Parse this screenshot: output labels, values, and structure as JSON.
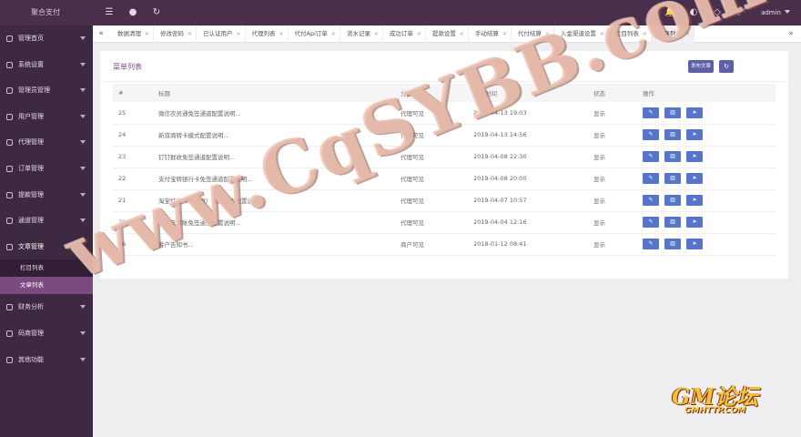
{
  "topbar": {
    "brand": "聚合支付",
    "admin": "admin"
  },
  "sidebar": {
    "items": [
      {
        "label": "管理首页"
      },
      {
        "label": "系统设置"
      },
      {
        "label": "管理员管理"
      },
      {
        "label": "用户管理"
      },
      {
        "label": "代理管理"
      },
      {
        "label": "订单管理"
      },
      {
        "label": "提款管理"
      },
      {
        "label": "通道管理"
      },
      {
        "label": "文章管理"
      }
    ],
    "sub_items": [
      {
        "label": "栏目列表"
      },
      {
        "label": "文章列表"
      }
    ],
    "items_after": [
      {
        "label": "财务分析"
      },
      {
        "label": "码商管理"
      },
      {
        "label": "其他功能"
      }
    ]
  },
  "tabs": [
    {
      "label": "数据清理"
    },
    {
      "label": "修改密码"
    },
    {
      "label": "已认证用户"
    },
    {
      "label": "代理列表"
    },
    {
      "label": "代付Api订单"
    },
    {
      "label": "流水记录"
    },
    {
      "label": "成功订单"
    },
    {
      "label": "提款设置"
    },
    {
      "label": "手动结算"
    },
    {
      "label": "代付结算"
    },
    {
      "label": "入金渠道设置"
    },
    {
      "label": "栏目列表"
    },
    {
      "label": "文章列表"
    }
  ],
  "card": {
    "title": "菜单列表",
    "add_label": "发布文章",
    "columns": {
      "id": "#",
      "title": "标题",
      "group": "分组",
      "time": "发表时间",
      "status": "状态",
      "ops": "操作"
    },
    "rows": [
      {
        "id": "25",
        "title": "微信农员通免签通道配置说明...",
        "group": "代理可见",
        "time": "2019-04-13 19:03",
        "status": "显示"
      },
      {
        "id": "24",
        "title": "新双商转卡模式配置说明...",
        "group": "代理可见",
        "time": "2019-04-13 14:56",
        "status": "显示"
      },
      {
        "id": "23",
        "title": "钉钉群收免签通道配置说明...",
        "group": "代理可见",
        "time": "2019-04-08 22:30",
        "status": "显示"
      },
      {
        "id": "22",
        "title": "支付宝转银行卡免签通道配置说明...",
        "group": "代理可见",
        "time": "2019-04-08 20:00",
        "status": "显示"
      },
      {
        "id": "21",
        "title": "淘宝红包（旺信群）免签通道配置说明...",
        "group": "代理可见",
        "time": "2019-04-07 10:57",
        "status": "显示"
      },
      {
        "id": "20",
        "title": "支付宝转账免签通道配置说明...",
        "group": "代理可见",
        "time": "2019-04-04 12:16",
        "status": "显示"
      },
      {
        "id": "16",
        "title": "客户告知书...",
        "group": "商户可见",
        "time": "2018-01-12 08:41",
        "status": "显示"
      }
    ]
  },
  "watermark": "www.CqSYBB.com",
  "logo": {
    "main": "GM论坛",
    "sub": "GMHTTP.COM"
  },
  "colors": {
    "sidebar": "#3e2942",
    "topbar": "#4a2f4d",
    "active_sub": "#7b4a7f",
    "action_button": "#5876c9",
    "primary": "#5f5fa8"
  },
  "icons": [
    "menu-icon",
    "globe-icon",
    "refresh-icon",
    "bell-icon",
    "palette-icon",
    "tag-icon",
    "fullscreen-icon",
    "edit-icon",
    "trash-icon",
    "send-icon"
  ]
}
